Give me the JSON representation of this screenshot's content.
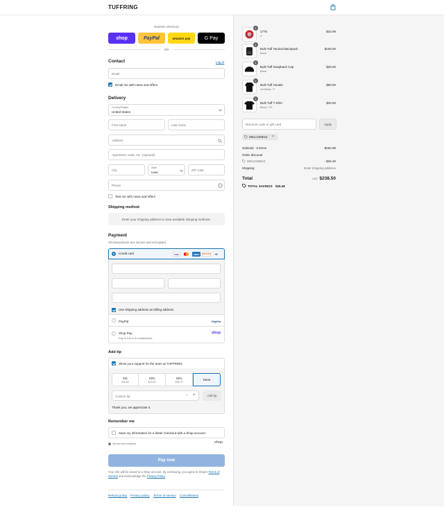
{
  "header": {
    "logo": "TUFFRING",
    "cart_icon": "shopping-bag-icon"
  },
  "express": {
    "title": "Express checkout",
    "shop": "shop",
    "paypal": "PayPal",
    "amazon": "amazon pay",
    "gpay": "G Pay",
    "or": "OR"
  },
  "contact": {
    "title": "Contact",
    "login": "Log in",
    "email_placeholder": "Email",
    "newsletter": "Email me with news and offers"
  },
  "delivery": {
    "title": "Delivery",
    "country_label": "Country/Region",
    "country_value": "United States",
    "first_name": "First name",
    "last_name": "Last name",
    "address": "Address",
    "apartment": "Apartment, suite, etc. (optional)",
    "city": "City",
    "state_label": "State",
    "state_value": "Iowa",
    "zip": "ZIP code",
    "phone": "Phone",
    "sms": "Text me with news and offers"
  },
  "shipping": {
    "title": "Shipping method",
    "message": "Enter your shipping address to view available shipping methods."
  },
  "payment": {
    "title": "Payment",
    "subtitle": "All transactions are secure and encrypted.",
    "credit_card": "Credit card",
    "cards": {
      "visa": "VISA",
      "amex": "AMEX",
      "discover": "DISCOVER",
      "more": "+5"
    },
    "billing_same": "Use shipping address as billing address",
    "paypal": "PayPal",
    "paypal_logo": "PayPal",
    "shop_pay": "Shop Pay",
    "shop_pay_sub": "Pay in full or in installments",
    "shop_logo": "shop"
  },
  "tip": {
    "title": "Add tip",
    "support": "Show your support for the team at TUFFRING",
    "options": [
      {
        "percent": "5%",
        "amount": "$11.80"
      },
      {
        "percent": "10%",
        "amount": "$23.60"
      },
      {
        "percent": "15%",
        "amount": "$35.70"
      }
    ],
    "none": "None",
    "custom_placeholder": "Custom tip",
    "add": "Add tip",
    "thanks": "Thank you, we appreciate it."
  },
  "remember": {
    "title": "Remember me",
    "save": "Save my information for a faster checkout with a Shop account",
    "secure": "Secure and encrypted",
    "shop_logo": "shop"
  },
  "pay": {
    "button": "Pay now",
    "legal_1": "Your info will be saved to a Shop account. By continuing, you agree to Shop's",
    "terms": "Terms of Service",
    "legal_2": "and acknowledge the",
    "privacy": "Privacy Policy",
    "legal_3": "."
  },
  "footer": {
    "links": [
      "Refund policy",
      "Privacy policy",
      "Terms of service",
      "Cancellations"
    ]
  },
  "summary": {
    "items": [
      {
        "name": "1776",
        "variant": "4",
        "price": "$34.99",
        "qty": "1"
      },
      {
        "name": "Built Tuff Tactical Backpack",
        "variant": "Black",
        "price": "$100.00",
        "qty": "1"
      },
      {
        "name": "Built Tuff Snapback Cap",
        "variant": "Black",
        "price": "$30.00",
        "qty": "1"
      },
      {
        "name": "Built Tuff Hoodie",
        "variant": "Jet Black / S",
        "price": "$60.00",
        "qty": "1"
      },
      {
        "name": "Built Tuff T-Shirt",
        "variant": "Black / XS",
        "price": "$40.00",
        "qty": "1"
      }
    ],
    "discount_placeholder": "Discount code or gift card",
    "apply": "Apply",
    "code_chip": "WELCOME10",
    "subtotal_label": "Subtotal · 5 items",
    "subtotal_value": "$264.99",
    "order_discount": "Order discount",
    "code": "WELCOME10",
    "discount_value": "- $26.49",
    "shipping_label": "Shipping",
    "shipping_value": "Enter shipping address",
    "total_label": "Total",
    "currency": "USD",
    "total_value": "$238.50",
    "savings_label": "TOTAL SAVINGS",
    "savings_value": "$26.49"
  }
}
